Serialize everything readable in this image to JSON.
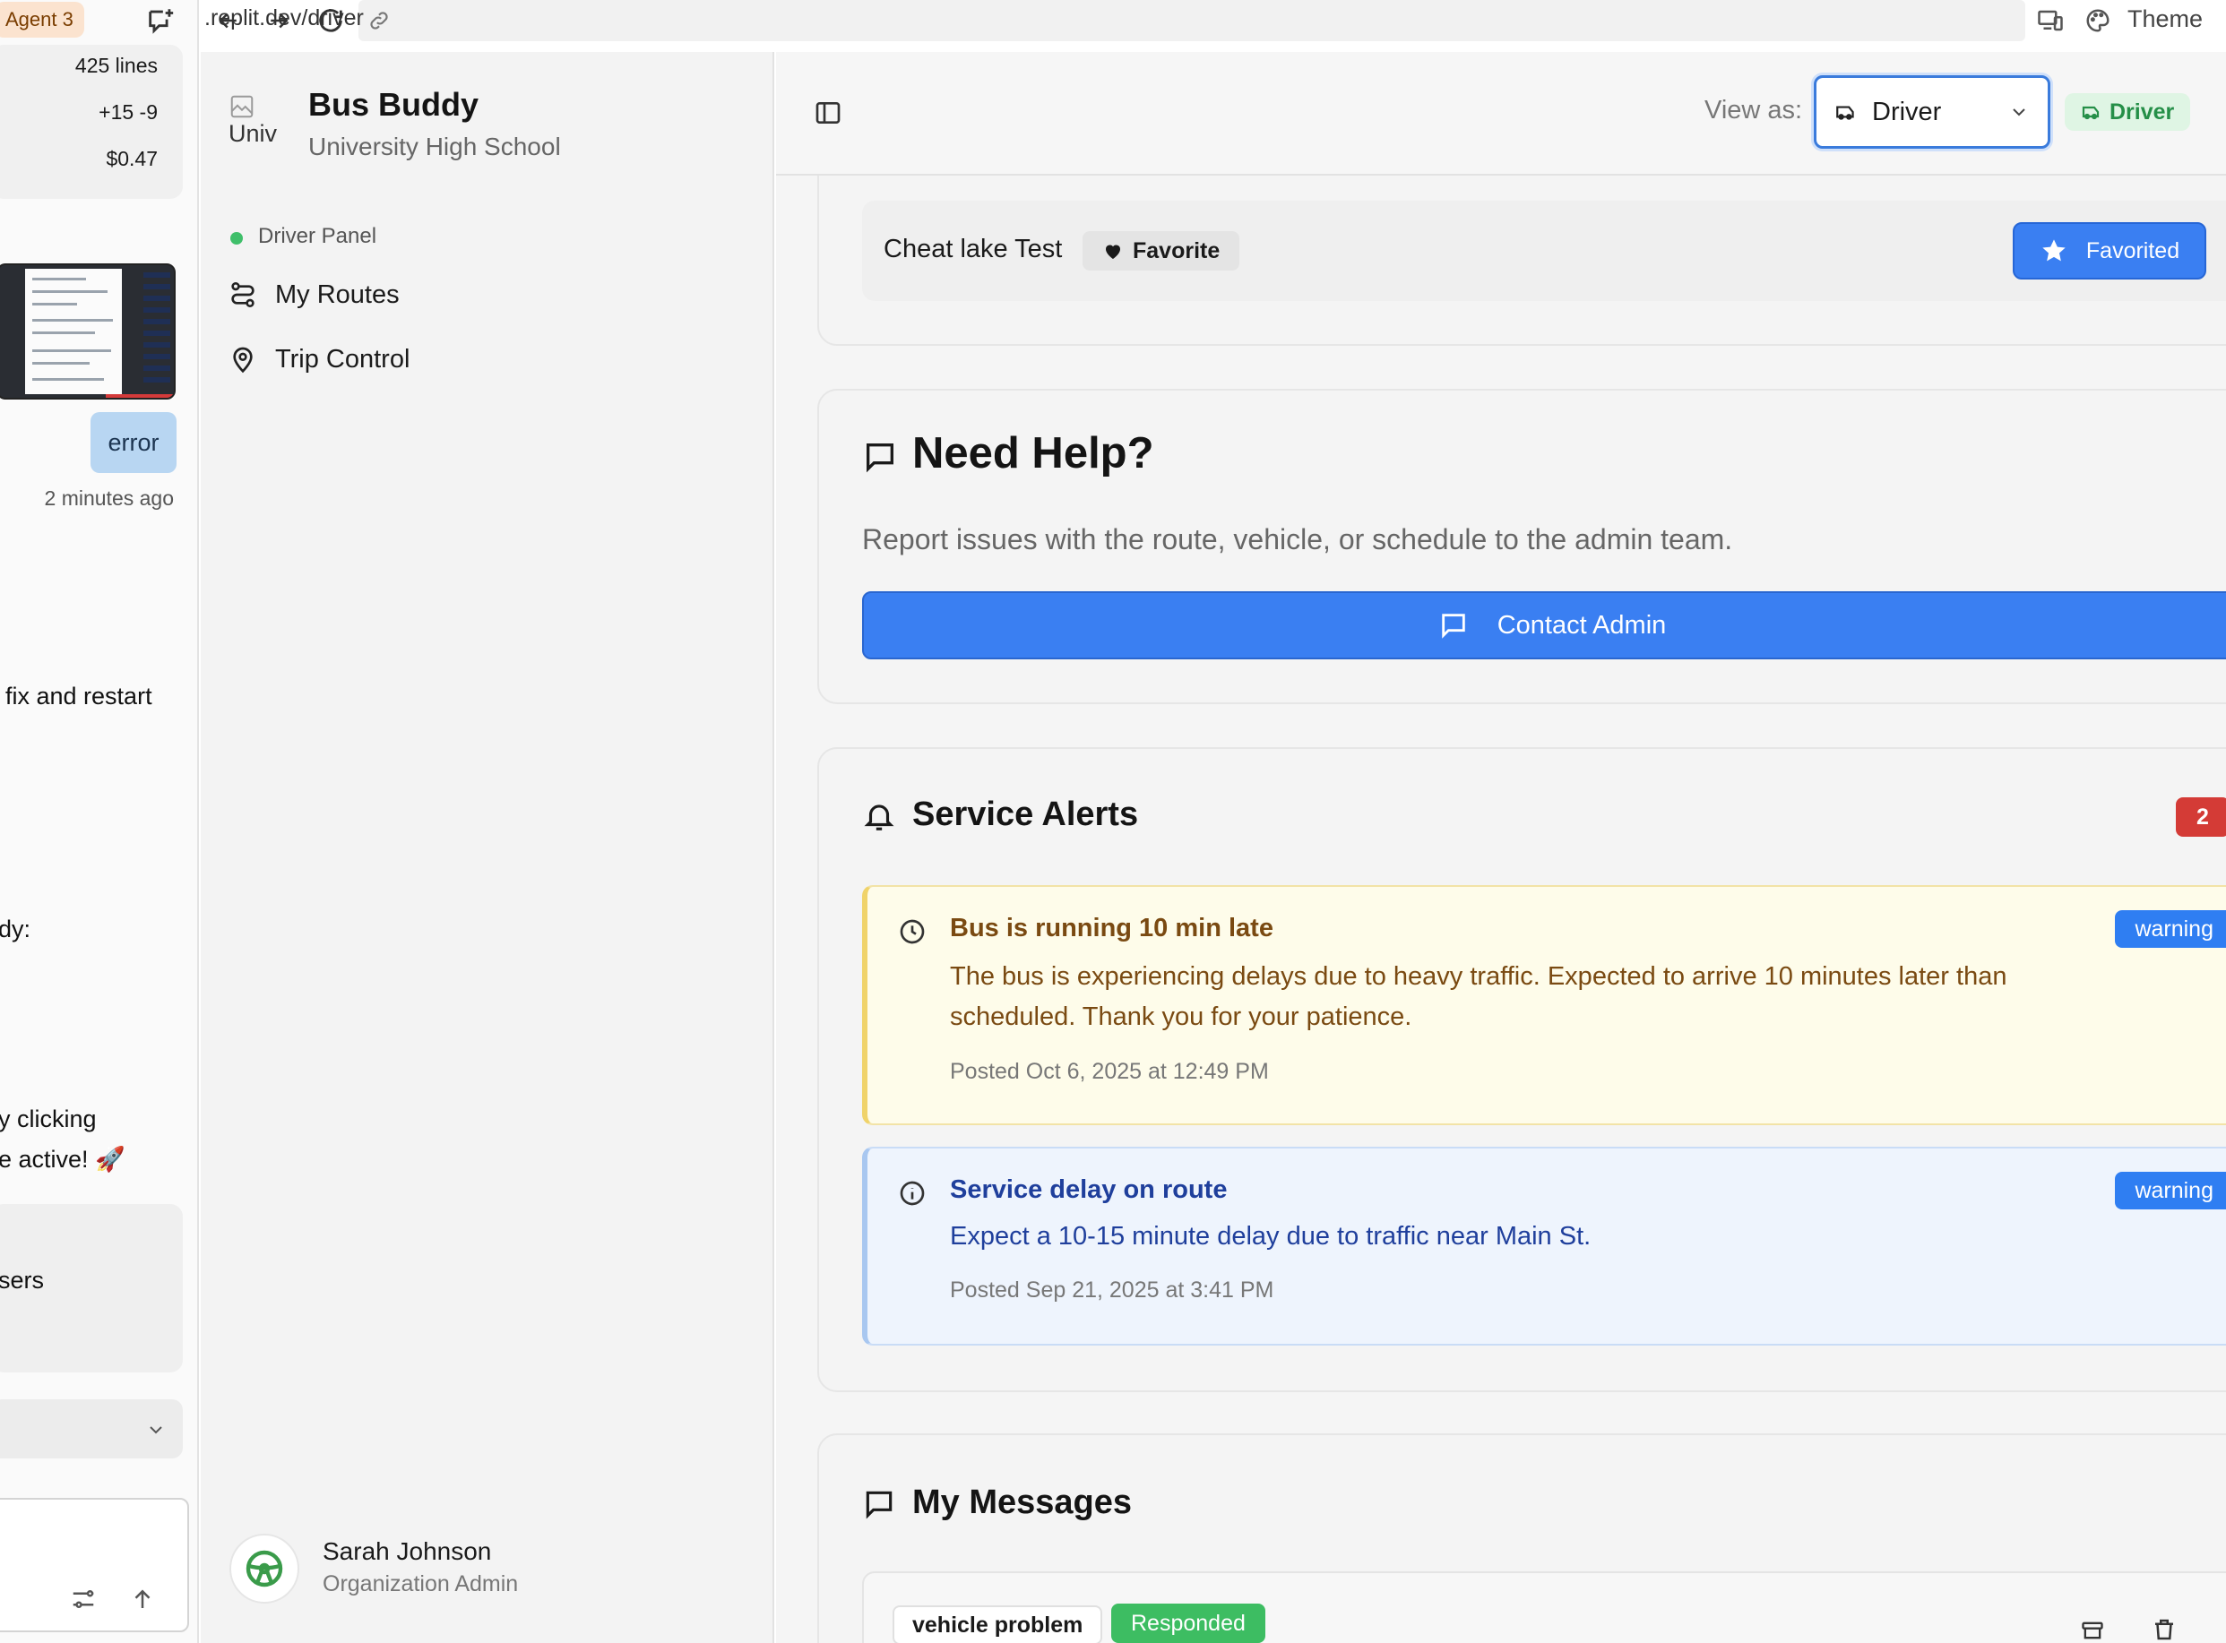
{
  "chat_pane": {
    "agent_badge": "Agent 3",
    "stats": {
      "lines": "425 lines",
      "diff": "+15 -9",
      "cost": "$0.47"
    },
    "error_message": "error",
    "error_time": "2 minutes ago",
    "fragments": [
      "fix and restart",
      "dy:",
      "y clicking",
      "e active! 🚀",
      "sers"
    ]
  },
  "browser": {
    "url": ".replit.dev/driver",
    "theme_label": "Theme"
  },
  "sidebar": {
    "logo_alt": "Univ",
    "app_title": "Bus Buddy",
    "school": "University High School",
    "panel_label": "Driver Panel",
    "nav": [
      {
        "label": "My Routes",
        "icon": "route-icon"
      },
      {
        "label": "Trip Control",
        "icon": "map-pin-icon"
      }
    ],
    "user": {
      "name": "Sarah Johnson",
      "role": "Organization Admin"
    }
  },
  "header": {
    "view_as_label": "View as:",
    "role_selected": "Driver",
    "role_badge": "Driver"
  },
  "favorites": {
    "route_name": "Cheat lake Test",
    "tag": "Favorite",
    "button": "Favorited"
  },
  "help": {
    "title": "Need Help?",
    "description": "Report issues with the route, vehicle, or schedule to the admin team.",
    "button": "Contact Admin"
  },
  "alerts": {
    "title": "Service Alerts",
    "count": "2",
    "items": [
      {
        "title": "Bus is running 10 min late",
        "body": "The bus is experiencing delays due to heavy traffic. Expected to arrive 10 minutes later than scheduled. Thank you for your patience.",
        "posted": "Posted Oct 6, 2025 at 12:49 PM",
        "severity": "warning"
      },
      {
        "title": "Service delay on route",
        "body": "Expect a 10-15 minute delay due to traffic near Main St.",
        "posted": "Posted Sep 21, 2025 at 3:41 PM",
        "severity": "warning"
      }
    ]
  },
  "messages": {
    "title": "My Messages",
    "items": [
      {
        "type": "vehicle problem",
        "status": "Responded"
      }
    ]
  },
  "colors": {
    "primary": "#3a7ff2",
    "success": "#3dbd62",
    "danger": "#d43b36",
    "warning_bg": "#fefcea",
    "info_bg": "#eef4fd"
  }
}
